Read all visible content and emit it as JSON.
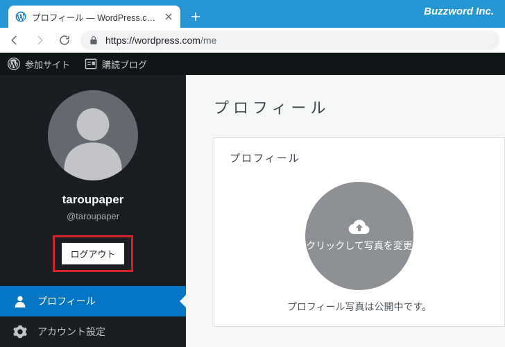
{
  "browser": {
    "tab_title": "プロフィール — WordPress.com",
    "brand": "Buzzword Inc.",
    "url_host": "https://wordpress.com",
    "url_path": "/me"
  },
  "adminbar": {
    "mysites": "参加サイト",
    "reader": "購読ブログ"
  },
  "sidebar": {
    "username": "taroupaper",
    "handle": "@taroupaper",
    "logout": "ログアウト",
    "menu": {
      "profile": "プロフィール",
      "account": "アカウント設定"
    }
  },
  "content": {
    "page_title": "プロフィール",
    "card_title": "プロフィール",
    "upload_text": "クリックして写真を変更",
    "photo_note": "プロフィール写真は公開中です。"
  }
}
